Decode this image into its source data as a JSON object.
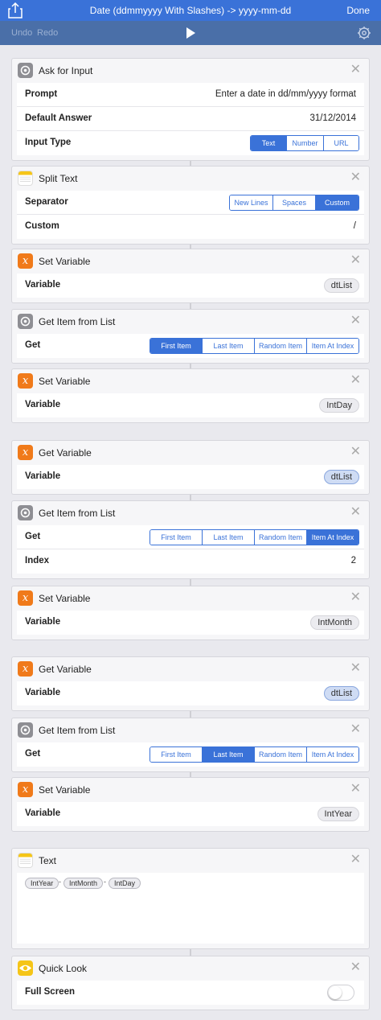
{
  "nav": {
    "title": "Date (ddmmyyyy With Slashes) -> yyyy-mm-dd",
    "done": "Done",
    "undo": "Undo",
    "redo": "Redo"
  },
  "colors": {
    "accent": "#3a72d8",
    "nav_bg": "#3a72d8",
    "toolbar_bg": "#4a6fa8",
    "variable_orange": "#f07a1a"
  },
  "actions": [
    {
      "name": "Ask for Input",
      "icon": "gear-icon",
      "prompt_label": "Prompt",
      "prompt_value": "Enter a date in dd/mm/yyyy format",
      "default_label": "Default Answer",
      "default_value": "31/12/2014",
      "type_label": "Input Type",
      "type_options": [
        "Text",
        "Number",
        "URL"
      ],
      "type_selected": "Text"
    },
    {
      "name": "Split Text",
      "icon": "notes-icon",
      "separator_label": "Separator",
      "separator_options": [
        "New Lines",
        "Spaces",
        "Custom"
      ],
      "separator_selected": "Custom",
      "custom_label": "Custom",
      "custom_value": "/"
    },
    {
      "name": "Set Variable",
      "icon": "variable-icon",
      "variable_label": "Variable",
      "variable_value": "dtList"
    },
    {
      "name": "Get Item from List",
      "icon": "gear-icon",
      "get_label": "Get",
      "options": [
        "First Item",
        "Last Item",
        "Random Item",
        "Item At Index"
      ],
      "selected": "First Item"
    },
    {
      "name": "Set Variable",
      "icon": "variable-icon",
      "variable_label": "Variable",
      "variable_value": "IntDay"
    },
    {
      "name": "Get Variable",
      "icon": "variable-icon",
      "variable_label": "Variable",
      "variable_value": "dtList"
    },
    {
      "name": "Get Item from List",
      "icon": "gear-icon",
      "get_label": "Get",
      "options": [
        "First Item",
        "Last Item",
        "Random Item",
        "Item At Index"
      ],
      "selected": "Item At Index",
      "index_label": "Index",
      "index_value": "2"
    },
    {
      "name": "Set Variable",
      "icon": "variable-icon",
      "variable_label": "Variable",
      "variable_value": "IntMonth"
    },
    {
      "name": "Get Variable",
      "icon": "variable-icon",
      "variable_label": "Variable",
      "variable_value": "dtList"
    },
    {
      "name": "Get Item from List",
      "icon": "gear-icon",
      "get_label": "Get",
      "options": [
        "First Item",
        "Last Item",
        "Random Item",
        "Item At Index"
      ],
      "selected": "Last Item"
    },
    {
      "name": "Set Variable",
      "icon": "variable-icon",
      "variable_label": "Variable",
      "variable_value": "IntYear"
    },
    {
      "name": "Text",
      "icon": "notes-icon",
      "tokens": [
        "IntYear",
        "-",
        "IntMonth",
        "-",
        "IntDay"
      ]
    },
    {
      "name": "Quick Look",
      "icon": "eye-icon",
      "fullscreen_label": "Full Screen",
      "fullscreen_on": false
    }
  ],
  "close_glyph": "✕"
}
